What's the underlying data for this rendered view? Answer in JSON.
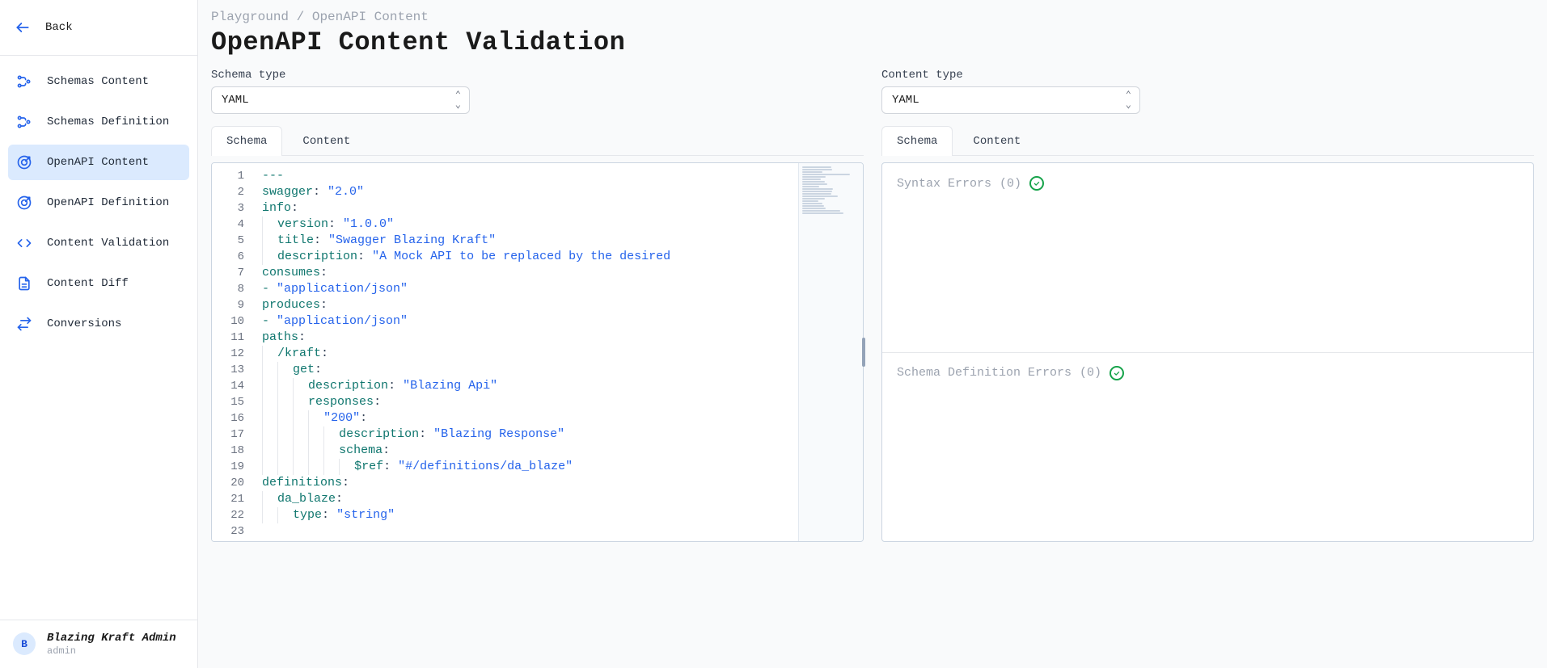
{
  "sidebar": {
    "back_label": "Back",
    "items": [
      {
        "label": "Schemas Content",
        "icon": "schema"
      },
      {
        "label": "Schemas Definition",
        "icon": "schema"
      },
      {
        "label": "OpenAPI Content",
        "icon": "target",
        "active": true
      },
      {
        "label": "OpenAPI Definition",
        "icon": "target"
      },
      {
        "label": "Content Validation",
        "icon": "code"
      },
      {
        "label": "Content Diff",
        "icon": "doc"
      },
      {
        "label": "Conversions",
        "icon": "swap"
      }
    ],
    "user": {
      "avatar_initial": "B",
      "name": "Blazing Kraft Admin",
      "role": "admin"
    }
  },
  "breadcrumb": {
    "parent": "Playground",
    "sep": "/",
    "current": "OpenAPI Content"
  },
  "page_title": "OpenAPI Content Validation",
  "left": {
    "select_label": "Schema type",
    "select_value": "YAML",
    "tabs": [
      "Schema",
      "Content"
    ],
    "active_tab": 0,
    "code_lines": [
      [
        {
          "t": "dash",
          "v": "---"
        }
      ],
      [
        {
          "t": "key",
          "v": "swagger"
        },
        {
          "t": "punct",
          "v": ": "
        },
        {
          "t": "str",
          "v": "\"2.0\""
        }
      ],
      [
        {
          "t": "key",
          "v": "info"
        },
        {
          "t": "punct",
          "v": ":"
        }
      ],
      [
        {
          "i": 1
        },
        {
          "t": "key",
          "v": "version"
        },
        {
          "t": "punct",
          "v": ": "
        },
        {
          "t": "str",
          "v": "\"1.0.0\""
        }
      ],
      [
        {
          "i": 1
        },
        {
          "t": "key",
          "v": "title"
        },
        {
          "t": "punct",
          "v": ": "
        },
        {
          "t": "str",
          "v": "\"Swagger Blazing Kraft\""
        }
      ],
      [
        {
          "i": 1
        },
        {
          "t": "key",
          "v": "description"
        },
        {
          "t": "punct",
          "v": ": "
        },
        {
          "t": "str",
          "v": "\"A Mock API to be replaced by the desired"
        }
      ],
      [
        {
          "t": "key",
          "v": "consumes"
        },
        {
          "t": "punct",
          "v": ":"
        }
      ],
      [
        {
          "t": "dash",
          "v": "- "
        },
        {
          "t": "str",
          "v": "\"application/json\""
        }
      ],
      [
        {
          "t": "key",
          "v": "produces"
        },
        {
          "t": "punct",
          "v": ":"
        }
      ],
      [
        {
          "t": "dash",
          "v": "- "
        },
        {
          "t": "str",
          "v": "\"application/json\""
        }
      ],
      [
        {
          "t": "key",
          "v": "paths"
        },
        {
          "t": "punct",
          "v": ":"
        }
      ],
      [
        {
          "i": 1
        },
        {
          "t": "key",
          "v": "/kraft"
        },
        {
          "t": "punct",
          "v": ":"
        }
      ],
      [
        {
          "i": 2
        },
        {
          "t": "key",
          "v": "get"
        },
        {
          "t": "punct",
          "v": ":"
        }
      ],
      [
        {
          "i": 3
        },
        {
          "t": "key",
          "v": "description"
        },
        {
          "t": "punct",
          "v": ": "
        },
        {
          "t": "str",
          "v": "\"Blazing Api\""
        }
      ],
      [
        {
          "i": 3
        },
        {
          "t": "key",
          "v": "responses"
        },
        {
          "t": "punct",
          "v": ":"
        }
      ],
      [
        {
          "i": 4
        },
        {
          "t": "str",
          "v": "\"200\""
        },
        {
          "t": "punct",
          "v": ":"
        }
      ],
      [
        {
          "i": 5
        },
        {
          "t": "key",
          "v": "description"
        },
        {
          "t": "punct",
          "v": ": "
        },
        {
          "t": "str",
          "v": "\"Blazing Response\""
        }
      ],
      [
        {
          "i": 5
        },
        {
          "t": "key",
          "v": "schema"
        },
        {
          "t": "punct",
          "v": ":"
        }
      ],
      [
        {
          "i": 6
        },
        {
          "t": "key",
          "v": "$ref"
        },
        {
          "t": "punct",
          "v": ": "
        },
        {
          "t": "str",
          "v": "\"#/definitions/da_blaze\""
        }
      ],
      [
        {
          "t": "key",
          "v": "definitions"
        },
        {
          "t": "punct",
          "v": ":"
        }
      ],
      [
        {
          "i": 1
        },
        {
          "t": "key",
          "v": "da_blaze"
        },
        {
          "t": "punct",
          "v": ":"
        }
      ],
      [
        {
          "i": 2
        },
        {
          "t": "key",
          "v": "type"
        },
        {
          "t": "punct",
          "v": ": "
        },
        {
          "t": "str",
          "v": "\"string\""
        }
      ],
      []
    ]
  },
  "right": {
    "select_label": "Content type",
    "select_value": "YAML",
    "tabs": [
      "Schema",
      "Content"
    ],
    "active_tab": 0,
    "sections": [
      {
        "title": "Syntax Errors",
        "count": 0
      },
      {
        "title": "Schema Definition Errors",
        "count": 0
      }
    ]
  }
}
